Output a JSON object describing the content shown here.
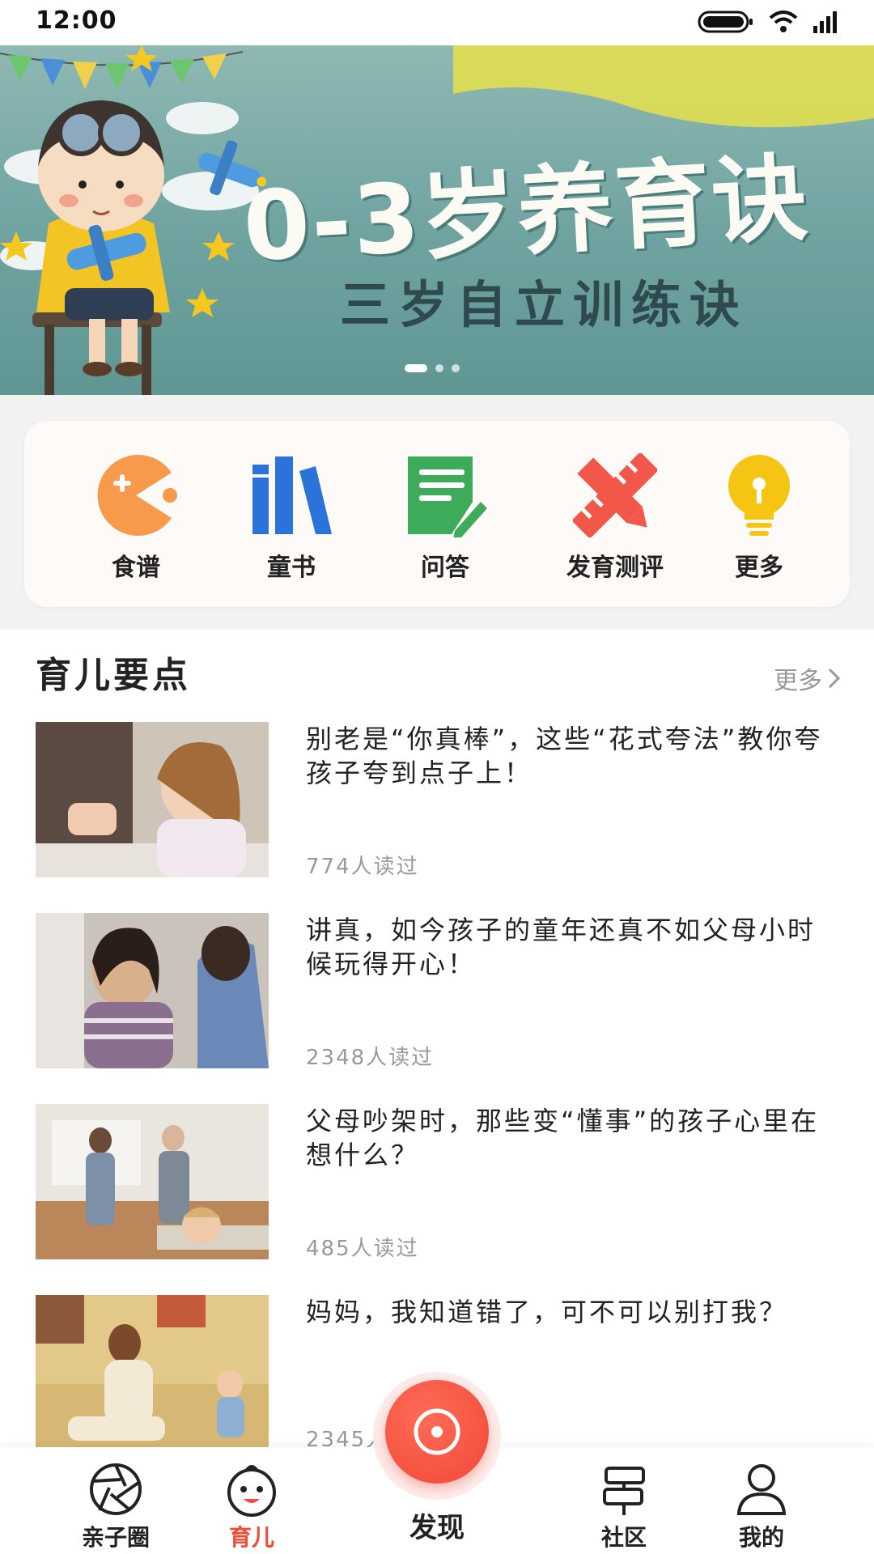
{
  "status_bar": {
    "time": "12:00"
  },
  "banner": {
    "title": "0-3岁养育诀",
    "subtitle": "三岁自立训练诀",
    "slide_count": 3,
    "active_slide": 1
  },
  "shortcuts": [
    {
      "label": "食谱",
      "icon": "pacman-icon",
      "color": "#f79a4c"
    },
    {
      "label": "童书",
      "icon": "books-icon",
      "color": "#2b73d9"
    },
    {
      "label": "问答",
      "icon": "note-pen-icon",
      "color": "#3dab5a"
    },
    {
      "label": "发育测评",
      "icon": "ruler-pencil-icon",
      "color": "#f2584a"
    },
    {
      "label": "更多",
      "icon": "lightbulb-icon",
      "color": "#f6c514"
    }
  ],
  "section": {
    "title": "育儿要点",
    "more_label": "更多"
  },
  "articles": [
    {
      "title": "别老是“你真棒”，这些“花式夸法”教你夸孩子夸到点子上！",
      "reads": "774人读过"
    },
    {
      "title": "讲真，如今孩子的童年还真不如父母小时候玩得开心！",
      "reads": "2348人读过"
    },
    {
      "title": "父母吵架时，那些变“懂事”的孩子心里在想什么？",
      "reads": "485人读过"
    },
    {
      "title": "妈妈，我知道错了，可不可以别打我？",
      "reads": "2345人读过"
    }
  ],
  "tab_bar": {
    "tabs": [
      {
        "label": "亲子圈",
        "icon": "aperture-icon"
      },
      {
        "label": "育儿",
        "icon": "baby-face-icon",
        "active": true
      },
      {
        "label": "发现",
        "icon": "discover-icon"
      },
      {
        "label": "社区",
        "icon": "signpost-icon"
      },
      {
        "label": "我的",
        "icon": "person-icon"
      }
    ],
    "accent_color": "#f44a3a"
  }
}
